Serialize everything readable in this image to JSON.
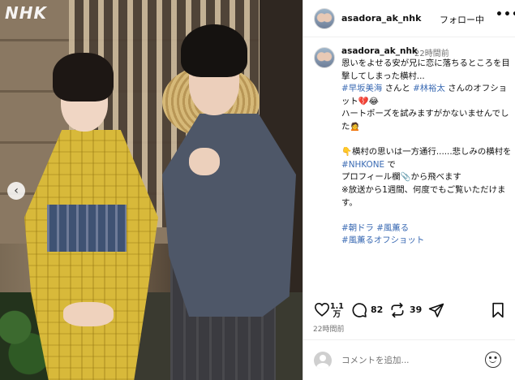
{
  "photo": {
    "logo": "NHK",
    "prev_icon": "‹"
  },
  "header": {
    "username": "asadora_ak_nhk",
    "follow_label": "フォロー中",
    "more_icon": "•••"
  },
  "caption": {
    "username": "asadora_ak_nhk",
    "time": "22時間前",
    "line1": "恩いをよせる安が兄に恋に落ちるところを目撃してしまった横村...\n",
    "tag1": "#早坂美海",
    "mid1": " さんと ",
    "tag2": "#林裕太",
    "line2": " さんのオフショット💔😂\nハートポーズを試みますがかないませんでした🙍\n\n👇横村の思いは一方通行......悲しみの横村を ",
    "tag3": "#NHKONE",
    "line3": " で\nプロフィール欄📎から飛べます\n※放送から1週間、何度でもご覧いただけます。\n\n",
    "tag4": "#朝ドラ",
    "sp1": " ",
    "tag5": "#風薫る",
    "sp2": "\n",
    "tag6": "#風薫るオフショット"
  },
  "actions": {
    "likes_top": "1.1",
    "likes_bottom": "万",
    "comments": "82",
    "reposts": "39",
    "icons": [
      "heart-icon",
      "comment-icon",
      "repost-icon",
      "share-icon",
      "bookmark-icon"
    ]
  },
  "post_time": "22時間前",
  "comment_box": {
    "placeholder": "コメントを追加..."
  }
}
